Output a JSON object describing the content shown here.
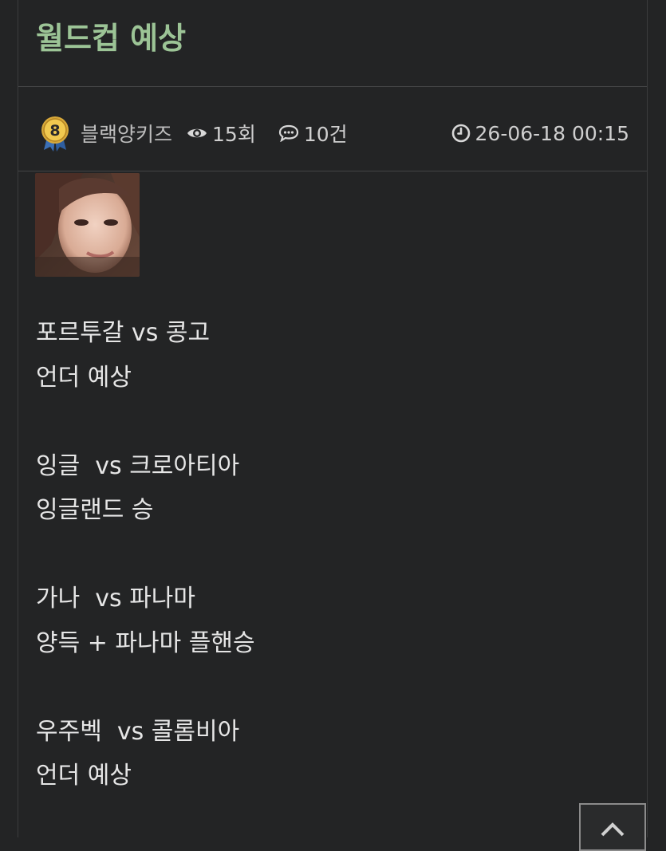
{
  "post": {
    "title": "월드컵 예상"
  },
  "meta": {
    "level": "8",
    "author": "블랙양키즈",
    "views": "15회",
    "comments": "10건",
    "datetime": "26-06-18 00:15",
    "icons": {
      "views": "eye-icon",
      "comments": "chat-bubble-icon",
      "datetime": "clock-icon",
      "level": "medal-icon"
    }
  },
  "body": {
    "lines": [
      "포르투갈 vs 콩고",
      "언더 예상",
      "",
      "잉글  vs 크로아티아",
      "잉글랜드 승",
      "",
      "가나  vs 파나마",
      "양득 + 파나마 플핸승",
      "",
      "우주벡  vs 콜롬비아",
      "언더 예상"
    ]
  },
  "colors": {
    "background": "#232425",
    "title": "#9cc496",
    "text": "#e6e6e6",
    "border": "#434445"
  },
  "controls": {
    "scroll_top_icon": "chevron-up-icon"
  }
}
